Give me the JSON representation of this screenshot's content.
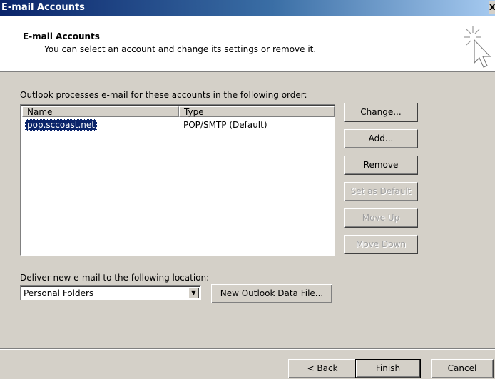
{
  "window": {
    "title": "E-mail Accounts",
    "close_glyph": "X"
  },
  "header": {
    "title": "E-mail Accounts",
    "subtitle": "You can select an account and change its settings or remove it.",
    "icon": "wizard-cursor-icon"
  },
  "accounts": {
    "order_label": "Outlook processes e-mail for these accounts in the following order:",
    "columns": [
      "Name",
      "Type"
    ],
    "rows": [
      {
        "name": "pop.sccoast.net",
        "type": "POP/SMTP (Default)",
        "selected": true
      }
    ]
  },
  "side_buttons": {
    "change": "Change...",
    "add": "Add...",
    "remove": "Remove",
    "set_default": "Set as Default",
    "move_up": "Move Up",
    "move_down": "Move Down"
  },
  "delivery": {
    "label": "Deliver new e-mail to the following location:",
    "selected": "Personal Folders",
    "new_file_button": "New Outlook Data File..."
  },
  "footer": {
    "back": "< Back",
    "finish": "Finish",
    "cancel": "Cancel"
  },
  "colors": {
    "dialog_bg": "#d4d0c8",
    "selection": "#0a246a",
    "title_start": "#0a246a",
    "title_end": "#a6caf0"
  }
}
